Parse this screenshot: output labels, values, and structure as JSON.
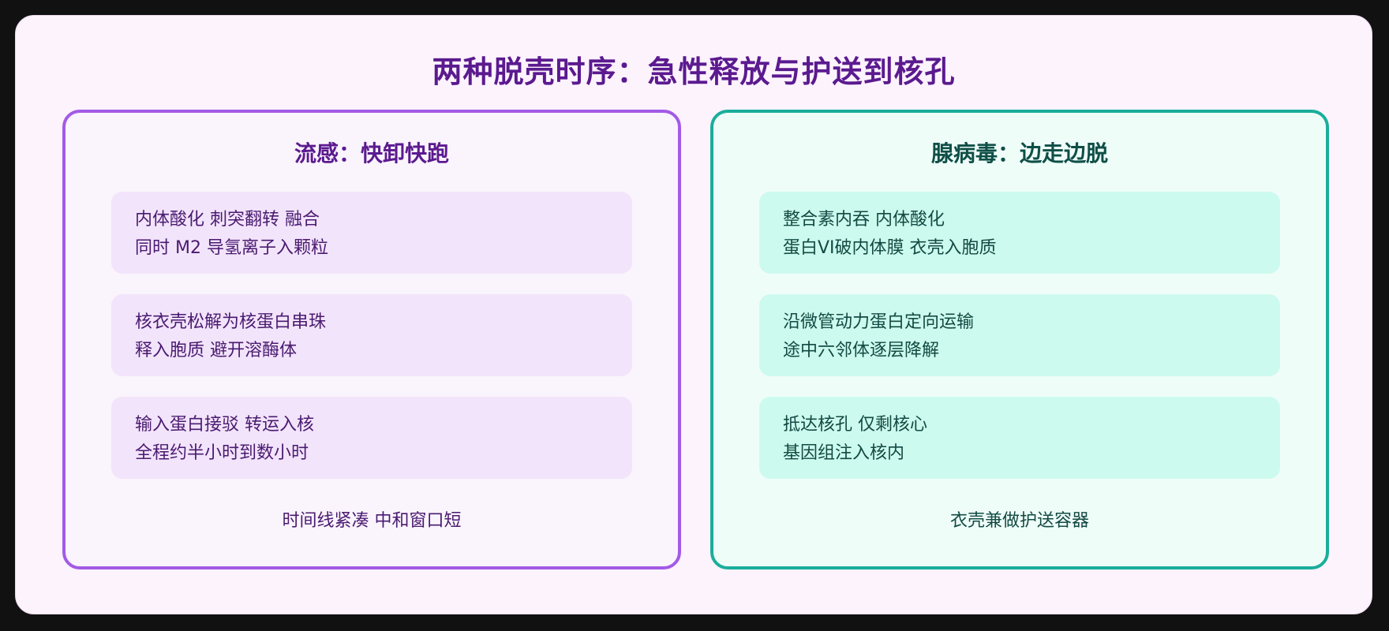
{
  "title": "两种脱壳时序：急性释放与护送到核孔",
  "panels": [
    {
      "title": "流感：快卸快跑",
      "steps": [
        [
          "内体酸化 刺突翻转 融合",
          "同时 M2 导氢离子入颗粒"
        ],
        [
          "核衣壳松解为核蛋白串珠",
          "释入胞质 避开溶酶体"
        ],
        [
          "输入蛋白接驳 转运入核",
          "全程约半小时到数小时"
        ]
      ],
      "footnote": "时间线紧凑 中和窗口短"
    },
    {
      "title": "腺病毒：边走边脱",
      "steps": [
        [
          "整合素内吞 内体酸化",
          "蛋白VI破内体膜 衣壳入胞质"
        ],
        [
          "沿微管动力蛋白定向运输",
          "途中六邻体逐层降解"
        ],
        [
          "抵达核孔 仅剩核心",
          "基因组注入核内"
        ]
      ],
      "footnote": "衣壳兼做护送容器"
    }
  ],
  "colors": {
    "background": "#111111",
    "card": "#fdf3fd",
    "title": "#5b1a8f",
    "influenza_border": "#a35ae6",
    "influenza_step": "#f2e4fb",
    "adenovirus_border": "#1aae9b",
    "adenovirus_step": "#cdfaee"
  }
}
